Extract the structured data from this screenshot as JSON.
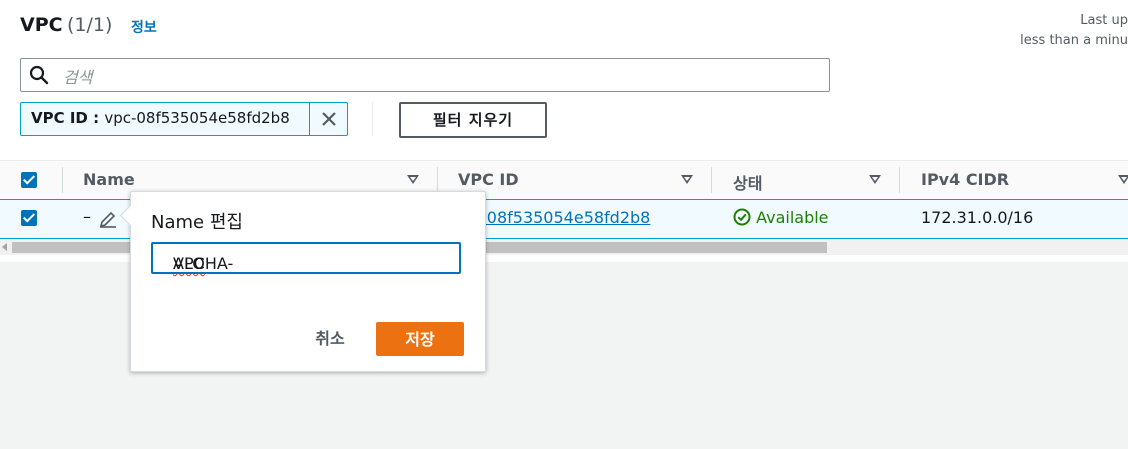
{
  "header": {
    "title": "VPC",
    "count": "(1/1)",
    "info_link": "정보"
  },
  "last_updated": {
    "line1": "Last up",
    "line2": "less than a minu"
  },
  "search": {
    "placeholder": "검색"
  },
  "filter_token": {
    "key": "VPC ID",
    "separator": " : ",
    "value": "vpc-08f535054e58fd2b8"
  },
  "clear_filters_label": "필터 지우기",
  "table": {
    "columns": [
      "Name",
      "VPC ID",
      "상태",
      "IPv4 CIDR"
    ],
    "rows": [
      {
        "name": "–",
        "vpc_id": "vpc-08f535054e58fd2b8",
        "vpc_id_visible": "-08f535054e58fd2b8",
        "status": "Available",
        "cidr": "172.31.0.0/16",
        "selected": true
      }
    ]
  },
  "popover": {
    "title": "Name 편집",
    "input_value_part1": "ALOHA-",
    "input_value_part2": "VPC",
    "cancel_label": "취소",
    "save_label": "저장"
  },
  "colors": {
    "accent": "#0073bb",
    "primary_button": "#ec7211",
    "success": "#1d8102"
  }
}
